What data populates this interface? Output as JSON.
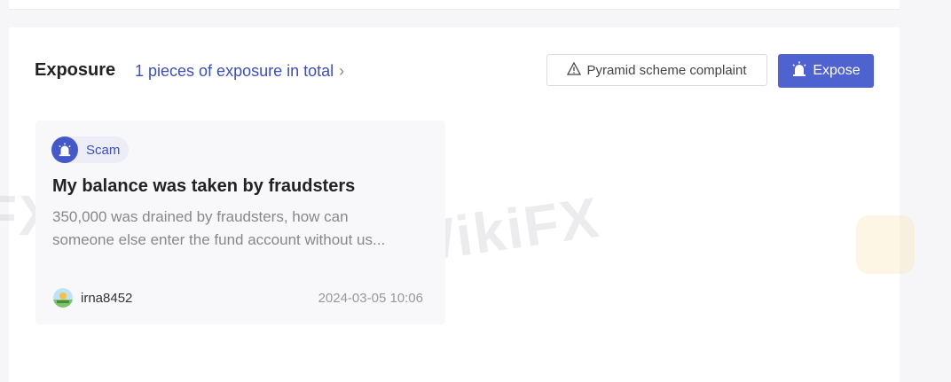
{
  "header": {
    "title": "Exposure",
    "link_text": "1 pieces of exposure in total",
    "complaint_button": "Pyramid scheme complaint",
    "expose_button": "Expose"
  },
  "card": {
    "tag": "Scam",
    "title": "My balance was taken by fraudsters",
    "body_line1": "350,000 was drained by fraudsters, how can",
    "body_line2": "someone else enter the fund account without us...",
    "username": "irna8452",
    "timestamp": "2024-03-05 10:06"
  },
  "watermark": "WikiFX",
  "colors": {
    "accent": "#4e63d0",
    "link": "#3b4fb8",
    "tag_bg": "#ecedf7"
  },
  "icons": {
    "complaint": "warning-triangle-icon",
    "expose": "alarm-icon",
    "tag": "alarm-icon",
    "link_chevron": "chevron-right-icon"
  }
}
